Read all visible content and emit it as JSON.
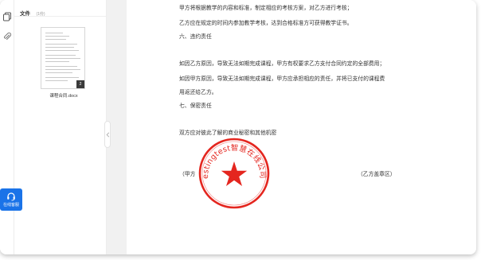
{
  "sidebar": {
    "file_icon": "document-stack-icon",
    "attach_icon": "paperclip-icon",
    "customer_service": {
      "icon": "headset-icon",
      "label": "在线客服"
    }
  },
  "file_panel": {
    "title": "文件",
    "count": "(1份)",
    "files": [
      {
        "name": "课程合同.docx",
        "page_badge": "2"
      }
    ]
  },
  "document": {
    "lines": [
      "甲方将根据教学的内容和标准，制定相应的考核方案，对乙方进行考核；",
      "乙方应在规定的时间内参加教学考核，达到合格标准方可获得教学证书。",
      "六、违约责任",
      "如因乙方原因，导致无法如期完成课程，甲方有权要求乙方支付合同约定的全部费用；",
      "如因甲方原因，导致无法如期完成课程，甲方应承担相应的责任，并将已支付的课程费",
      "用返还给乙方。",
      "七、保密责任",
      "双方应对彼此了解的商业秘密和其他机密",
      "（甲方",
      "（乙方盖章区）"
    ],
    "seal_text": "estingtest智慧在线公司",
    "seal_color": "#e4261f"
  },
  "colors": {
    "accent": "#1a73e8",
    "viewer_bg": "#f1f1f1"
  }
}
